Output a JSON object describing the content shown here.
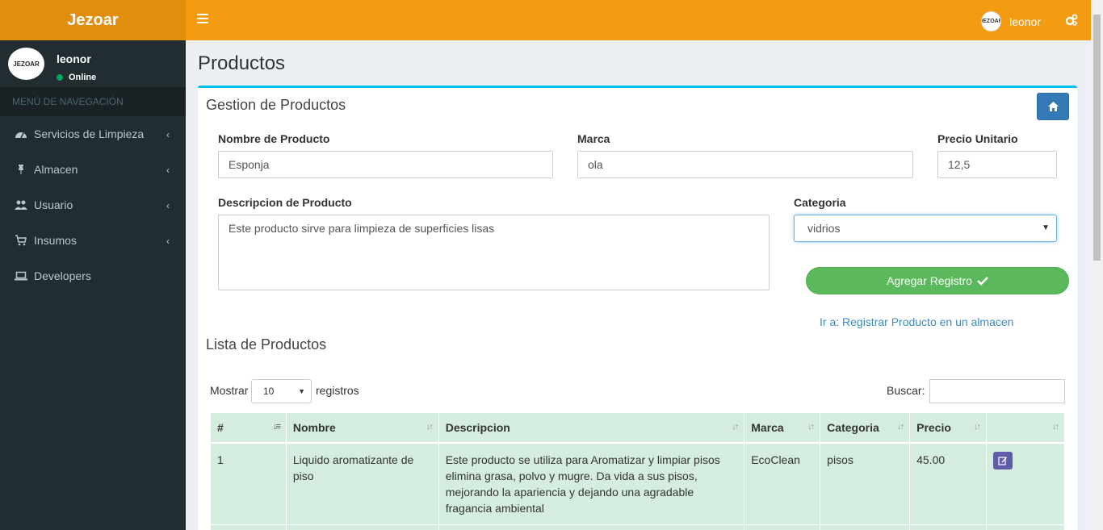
{
  "brand": "Jezoar",
  "header": {
    "user_name": "leonor",
    "avatar_text": "JEZOAR"
  },
  "sidebar": {
    "user_name": "leonor",
    "status": "Online",
    "avatar_text": "JEZOAR",
    "nav_header": "MENÚ DE NAVEGACIÓN",
    "items": [
      {
        "label": "Servicios de Limpieza",
        "icon": "dashboard-icon"
      },
      {
        "label": "Almacen",
        "icon": "thumbtack-icon"
      },
      {
        "label": "Usuario",
        "icon": "users-icon"
      },
      {
        "label": "Insumos",
        "icon": "cart-icon"
      },
      {
        "label": "Developers",
        "icon": "laptop-icon"
      }
    ]
  },
  "page": {
    "title": "Productos",
    "box_title": "Gestion de Productos",
    "form": {
      "nombre_label": "Nombre de Producto",
      "nombre_value": "Esponja",
      "marca_label": "Marca",
      "marca_value": "ola",
      "precio_label": "Precio Unitario",
      "precio_value": "12,5",
      "descripcion_label": "Descripcion de Producto",
      "descripcion_value": "Este producto sirve para limpieza de superficies lisas",
      "categoria_label": "Categoria",
      "categoria_value": "vidrios",
      "submit_label": "Agregar Registro",
      "link_label": "Ir a: Registrar Producto en un almacen"
    },
    "list_title": "Lista de Productos",
    "table_controls": {
      "show_label": "Mostrar",
      "show_value": "10",
      "records_label": "registros",
      "search_label": "Buscar:"
    },
    "table": {
      "columns": [
        "#",
        "Nombre",
        "Descripcion",
        "Marca",
        "Categoria",
        "Precio",
        ""
      ],
      "rows": [
        {
          "num": "1",
          "nombre": "Liquido aromatizante de piso",
          "descripcion": "Este producto se utiliza para Aromatizar y limpiar pisos elimina grasa, polvo y mugre. Da vida a sus pisos, mejorando la apariencia y dejando una agradable fragancia ambiental",
          "marca": "EcoClean",
          "categoria": "pisos",
          "precio": "45.00"
        }
      ]
    }
  },
  "colors": {
    "header": "#f39c12",
    "logo_bg": "#e08e0b",
    "sidebar": "#222d32",
    "box_border": "#00c0ef",
    "success": "#5cb85c",
    "primary": "#337ab7",
    "edit": "#605ca8",
    "row_bg": "#d5eddf"
  }
}
